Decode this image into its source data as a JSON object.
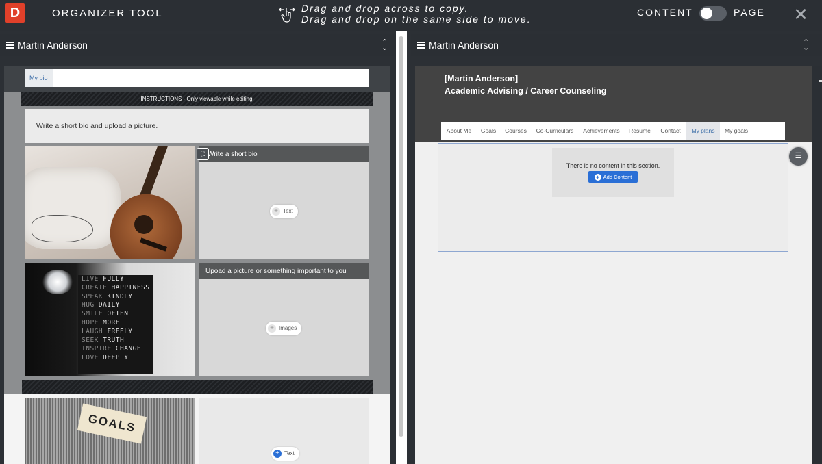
{
  "topbar": {
    "logo_letter": "D",
    "title": "ORGANIZER TOOL",
    "instructions_line1": "Drag and drop across to copy.",
    "instructions_line2": "Drag and drop on the same side to move.",
    "mode_content_label": "CONTENT",
    "mode_page_label": "PAGE",
    "mode_toggle_state": "content",
    "close_icon": "close-icon",
    "close_glyph": "✕"
  },
  "left_panel": {
    "portfolio_name": "Martin Anderson",
    "tabs": [
      {
        "label": "My bio"
      }
    ],
    "instructions_banner": "INSTRUCTIONS - Only viewable while editing",
    "instructions_text": "Write a short bio and upload a picture.",
    "blocks": [
      {
        "heading": "Write a short bio",
        "add_label": "Text"
      },
      {
        "heading": "Upoad a picture or something important to you",
        "add_label": "Images"
      },
      {
        "heading": "",
        "add_label": "Text"
      }
    ],
    "sign_lines": [
      [
        "LIVE",
        "FULLY"
      ],
      [
        "CREATE",
        "HAPPINESS"
      ],
      [
        "SPEAK",
        "KINDLY"
      ],
      [
        "HUG",
        "DAILY"
      ],
      [
        "SMILE",
        "OFTEN"
      ],
      [
        "HOPE",
        "MORE"
      ],
      [
        "LAUGH",
        "FREELY"
      ],
      [
        "SEEK",
        "TRUTH"
      ],
      [
        "INSPIRE",
        "CHANGE"
      ],
      [
        "LOVE",
        "DEEPLY"
      ]
    ],
    "goals_tag_text": "GOALS"
  },
  "right_panel": {
    "portfolio_name": "Martin Anderson",
    "page_name": "[Martin Anderson]",
    "page_subtitle": "Academic Advising / Career Counseling",
    "nav": [
      {
        "label": "About Me",
        "active": false
      },
      {
        "label": "Goals",
        "active": false
      },
      {
        "label": "Courses",
        "active": false
      },
      {
        "label": "Co-Curriculars",
        "active": false
      },
      {
        "label": "Achievements",
        "active": false
      },
      {
        "label": "Resume",
        "active": false
      },
      {
        "label": "Contact",
        "active": false
      },
      {
        "label": "My plans",
        "active": true
      },
      {
        "label": "My goals",
        "active": false
      }
    ],
    "empty_message": "There is no content in this section.",
    "add_content_label": "Add Content"
  },
  "colors": {
    "logo_red": "#e0402a",
    "accent_blue": "#2a6fd6",
    "dark_bar": "#2b2f34"
  }
}
